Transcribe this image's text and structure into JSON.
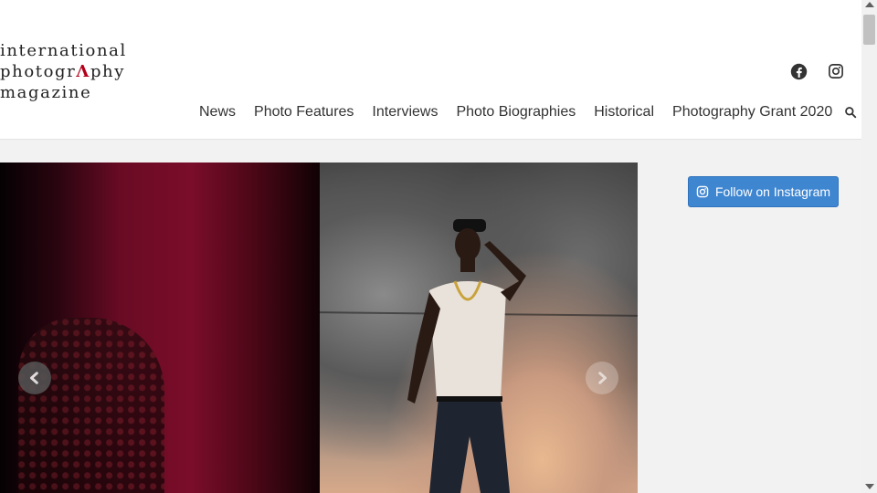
{
  "logo": {
    "line1": "international",
    "line2_pre": "photogr",
    "line2_accent": "Λ",
    "line2_post": "phy",
    "line3": "magazine"
  },
  "social": {
    "facebook": "facebook-icon",
    "instagram": "instagram-icon"
  },
  "nav": {
    "items": [
      "News",
      "Photo Features",
      "Interviews",
      "Photo Biographies",
      "Historical",
      "Photography Grant 2020"
    ],
    "search_icon": "search-icon"
  },
  "sidebar": {
    "follow_label": "Follow on Instagram"
  },
  "colors": {
    "accent": "#b3001b",
    "button": "#3f86d1",
    "text": "#333333"
  }
}
